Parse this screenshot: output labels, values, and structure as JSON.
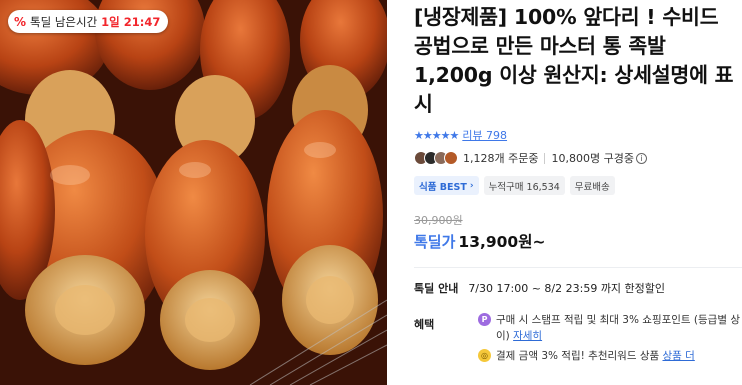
{
  "timer_badge": {
    "icon": "percent-icon",
    "label": "톡딜 남은시간",
    "time": "1일 21:47"
  },
  "product": {
    "title": "[냉장제품] 100% 앞다리 ! 수비드 공법으로 만든 마스터 통 족발 1,200g 이상 원산지: 상세설명에 표시",
    "rating_stars": "★★★★★",
    "review_label": "리뷰 798",
    "buyers_text": "1,128개 주문중",
    "favorites_text": "10,800명 구경중",
    "info_icon": "info-icon",
    "chips": [
      {
        "label": "식품 BEST",
        "chevron": "›"
      },
      {
        "label": "누적구매 16,534"
      },
      {
        "label": "무료배송"
      }
    ],
    "original_price": "30,900원",
    "price_label": "톡딜가",
    "price": "13,900원~",
    "deal": {
      "key": "톡딜 안내",
      "text": "7/30 17:00 ~ 8/2 23:59 까지 한정할인"
    },
    "benefit_key": "혜택",
    "benefits": [
      {
        "icon": "point-icon",
        "icon_text": "P",
        "text": "구매 시 스탬프 적립 및 최대 3% 쇼핑포인트 (등급별 상이)",
        "link": "자세히"
      },
      {
        "icon": "coin-icon",
        "icon_text": "◎",
        "text": "결제 금액 3% 적립! 추천리워드 상품",
        "link": "상품 더"
      }
    ]
  },
  "colors": {
    "accent_blue": "#3f78e8",
    "timer_red": "#f2262c",
    "meat_dark": "#3a1206",
    "meat_light": "#c8541e"
  }
}
